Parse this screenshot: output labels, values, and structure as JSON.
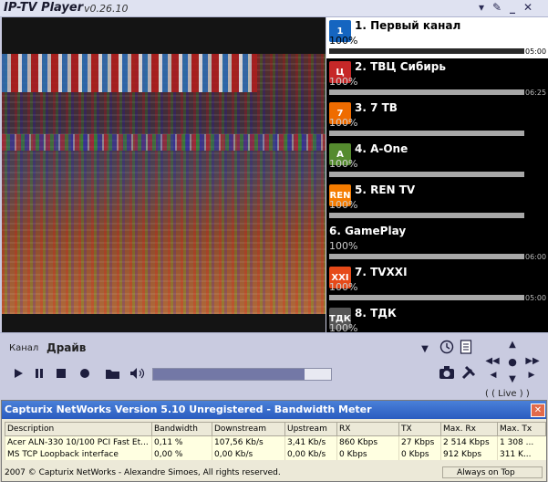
{
  "app": {
    "title": "IP-TV Player",
    "version": "v0.26.10"
  },
  "window_buttons": {
    "menu": "▾",
    "pin": "✎",
    "minimize": "_",
    "close": "✕"
  },
  "channels": [
    {
      "name": "1. Первый канал",
      "percent": "100%",
      "time": "05:00",
      "logo_text": "1",
      "logo_color": "#1565c0",
      "progress": 1.0,
      "selected": true
    },
    {
      "name": "2. ТВЦ Сибирь",
      "percent": "100%",
      "time": "06:25",
      "logo_text": "Ц",
      "logo_color": "#c62828",
      "progress": 1.0
    },
    {
      "name": "3. 7 ТВ",
      "percent": "100%",
      "time": "",
      "logo_text": "7",
      "logo_color": "#ef6c00",
      "progress": 1.0
    },
    {
      "name": "4. A-One",
      "percent": "100%",
      "time": "",
      "logo_text": "A",
      "logo_color": "#558b2f",
      "progress": 1.0
    },
    {
      "name": "5. REN TV",
      "percent": "100%",
      "time": "",
      "logo_text": "REN",
      "logo_color": "#f57c00",
      "progress": 1.0
    },
    {
      "name": "6. GamePlay",
      "percent": "100%",
      "time": "06:00",
      "logo_text": "",
      "logo_color": "",
      "progress": 1.0
    },
    {
      "name": "7. TVXXI",
      "percent": "100%",
      "time": "05:00",
      "logo_text": "XXI",
      "logo_color": "#e64a19",
      "progress": 1.0
    },
    {
      "name": "8. ТДК",
      "percent": "100%",
      "time": "",
      "logo_text": "ТДК",
      "logo_color": "#555555",
      "progress": 1.0
    }
  ],
  "controls": {
    "tab_channel": "Канал",
    "tab_drive": "Драйв",
    "live_label": "( ( Live ) )",
    "volume": 0.85
  },
  "networks": {
    "title": "Capturix NetWorks Version 5.10  Unregistered - Bandwidth Meter",
    "close": "✕",
    "columns": [
      "Description",
      "Bandwidth",
      "Downstream",
      "Upstream",
      "RX",
      "TX",
      "Max. Rx",
      "Max. Tx"
    ],
    "rows": [
      [
        "Acer ALN-330 10/100 PCI Fast Et...",
        "0,11 %",
        "107,56 Kb/s",
        "3,41 Kb/s",
        "860 Kbps",
        "27 Kbps",
        "2 514 Kbps",
        "1 308 ..."
      ],
      [
        "MS TCP Loopback interface",
        "0,00 %",
        "0,00 Kb/s",
        "0,00 Kb/s",
        "0 Kbps",
        "0 Kbps",
        "912 Kbps",
        "311 K..."
      ]
    ],
    "copyright": "2007 © Capturix NetWorks - Alexandre Simoes, All rights reserved.",
    "always_on_top": "Always on Top"
  }
}
